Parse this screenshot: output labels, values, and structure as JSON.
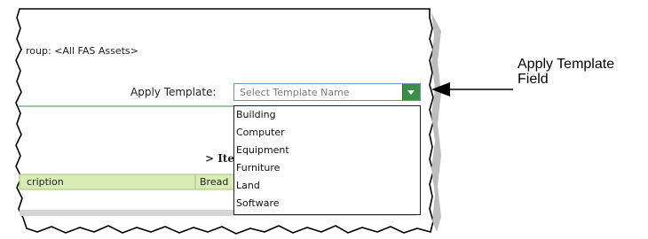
{
  "group_label": "roup: <All FAS Assets>",
  "apply_template": {
    "label": "Apply Template:",
    "placeholder": "Select Template Name",
    "options": [
      "Building",
      "Computer",
      "Equipment",
      "Furniture",
      "Land",
      "Software"
    ]
  },
  "section_title": "> Ite",
  "table_headers": [
    "cription",
    "Bread"
  ],
  "callout": {
    "line1": "Apply Template",
    "line2": "Field"
  },
  "colors": {
    "accent_green": "#3b8f45",
    "panel_border": "#7fb57f",
    "header_bg": "#d9ecb5"
  }
}
